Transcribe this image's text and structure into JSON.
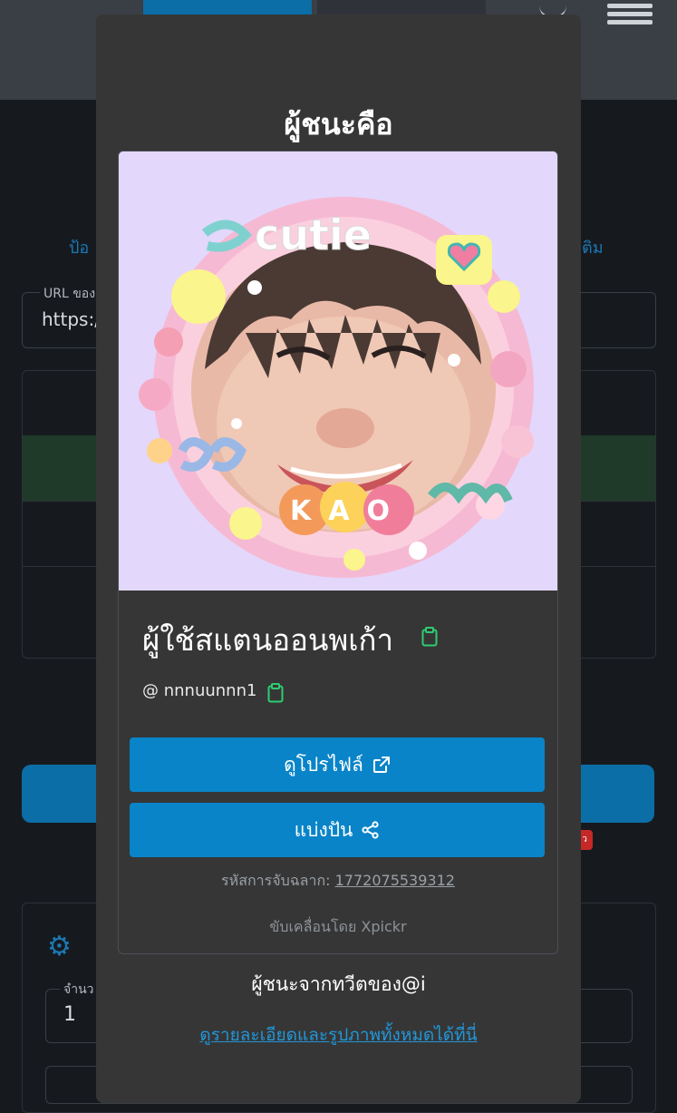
{
  "background": {
    "left_text": "ป้อ",
    "right_text": "ติม",
    "url_label": "URL ของ",
    "url_value": "https:/",
    "count_label": "จำนว",
    "count_value": "1",
    "badge": "ว",
    "icon_gear": "gear-icon"
  },
  "modal": {
    "title": "ผู้ชนะคือ",
    "winner": {
      "display_name": "ผู้ใช้สแตนออนพเก้า",
      "handle": "@ nnnuunnn1",
      "photo_text_top": "cutie",
      "photo_text_bottom": "KAO"
    },
    "buttons": {
      "profile_label": "ดูโปรไฟล์",
      "share_label": "แบ่งปัน"
    },
    "draw_id_label": "รหัสการจับฉลาก:",
    "draw_id_value": "1772075539312",
    "powered_by": "ขับเคลื่อนโดย Xpickr",
    "tweet_from": "ผู้ชนะจากทวีตของ@i",
    "details_link": "ดูรายละเอียดและรูปภาพทั้งหมดได้ที่นี่"
  },
  "colors": {
    "accent": "#0984c8",
    "copy_icon": "#2ecc71",
    "link": "#2196d9",
    "modal_bg": "#363636",
    "photo_bg": "#e3d7fb"
  }
}
